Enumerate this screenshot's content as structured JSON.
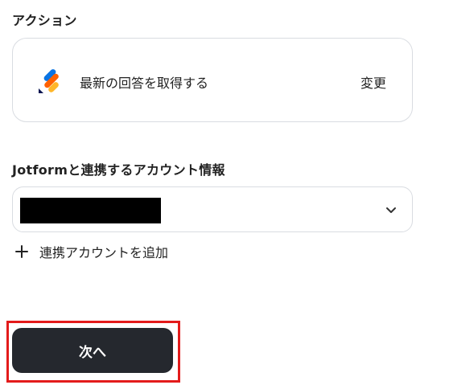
{
  "action_section": {
    "title": "アクション",
    "card": {
      "app_icon": "jotform-logo-icon",
      "label": "最新の回答を取得する",
      "change_label": "変更"
    }
  },
  "account_section": {
    "title": "Jotformと連携するアカウント情報",
    "select": {
      "value_redacted": true,
      "dropdown_icon": "chevron-down-icon"
    },
    "add_account": {
      "icon": "plus-icon",
      "label": "連携アカウントを追加"
    }
  },
  "footer": {
    "next_label": "次へ",
    "highlight_color": "#e31b1b",
    "button_color": "#25282e"
  },
  "brand_colors": {
    "jotform_blue": "#0a74e3",
    "jotform_orange": "#ff6100",
    "jotform_yellow": "#ffb629",
    "jotform_navy": "#0a1551"
  }
}
